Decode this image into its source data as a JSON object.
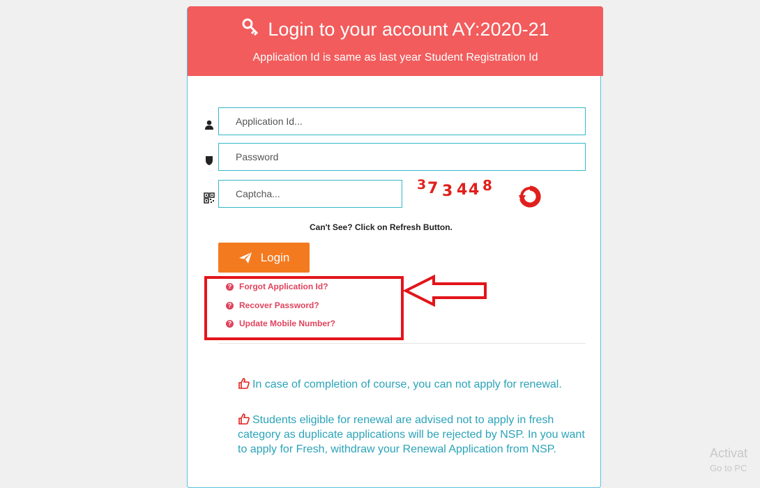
{
  "header": {
    "title": "Login to your account AY:2020-21",
    "subtitle": "Application Id is same as last year Student Registration Id"
  },
  "form": {
    "application_id_placeholder": "Application Id...",
    "password_placeholder": "Password",
    "captcha_placeholder": "Captcha...",
    "captcha_chars": [
      "3",
      "7",
      "3",
      "4",
      "4",
      "8"
    ],
    "refresh_hint": "Can't See? Click on Refresh Button.",
    "login_label": "Login"
  },
  "links": {
    "forgot_id": "Forgot Application Id?",
    "recover_password": "Recover Password?",
    "update_mobile": "Update Mobile Number?"
  },
  "notes": [
    "In case of completion of course, you can not apply for renewal.",
    "Students eligible for renewal are advised not to apply in fresh category as duplicate applications will be rejected by NSP. In you want to apply for Fresh, withdraw your Renewal Application from NSP."
  ],
  "watermark": {
    "line1": "Activat",
    "line2": "Go to PC"
  },
  "colors": {
    "header_bg": "#f25c5c",
    "login_button": "#f47a20",
    "input_border": "#35b7c8",
    "link": "#e0435c",
    "note_text": "#2aa3b8"
  }
}
